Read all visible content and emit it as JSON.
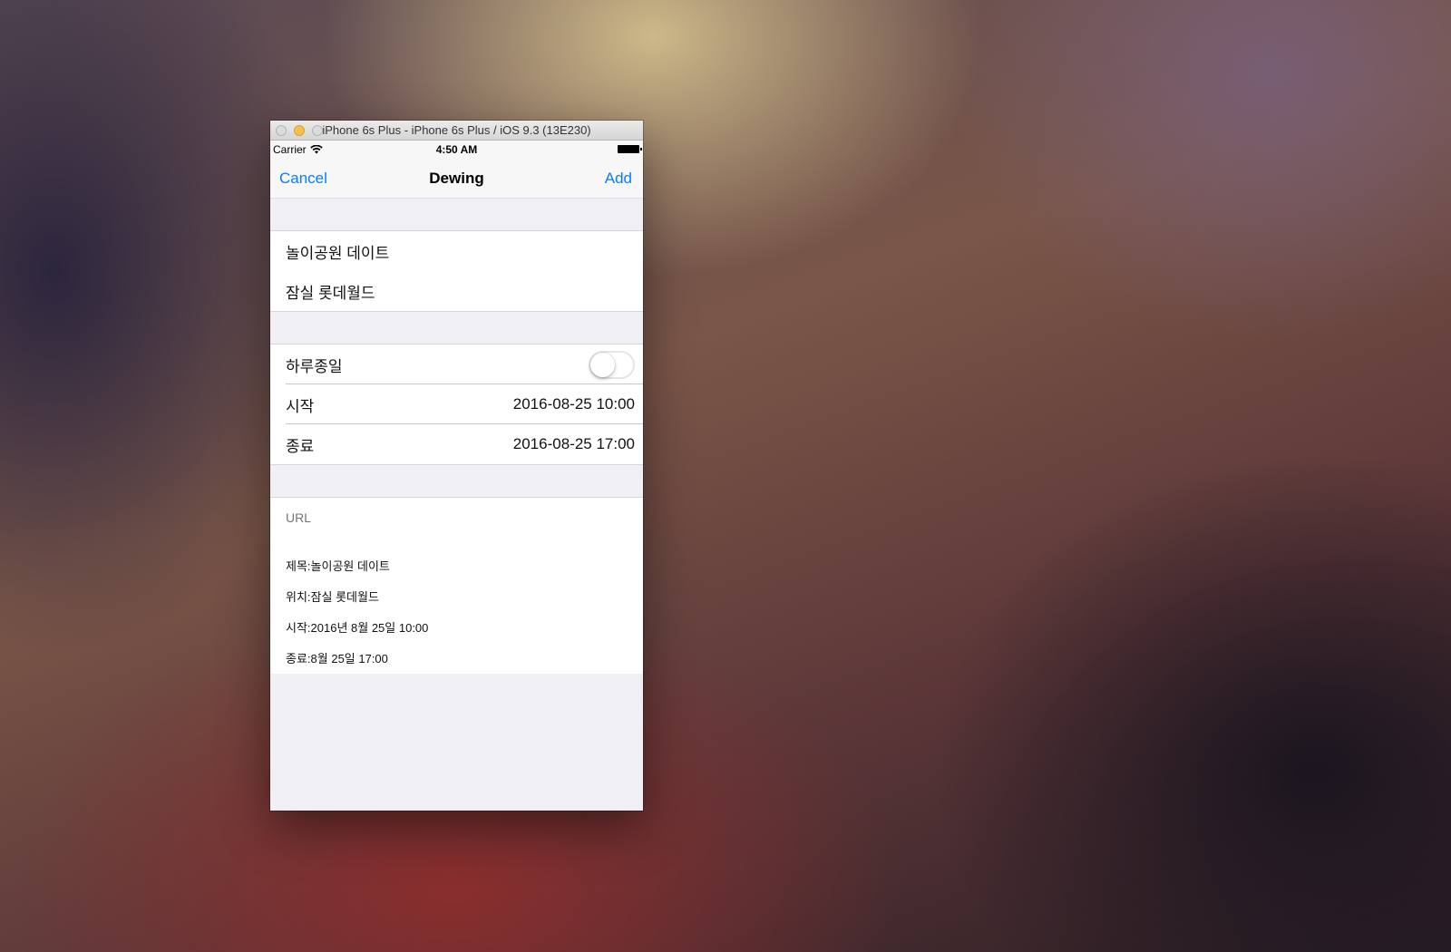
{
  "window": {
    "title": "iPhone 6s Plus - iPhone 6s Plus / iOS 9.3 (13E230)"
  },
  "status_bar": {
    "carrier": "Carrier",
    "time": "4:50 AM"
  },
  "nav": {
    "cancel_label": "Cancel",
    "title": "Dewing",
    "add_label": "Add"
  },
  "event": {
    "title_value": "놀이공원 데이트",
    "location_value": "잠실 롯데월드",
    "all_day_label": "하루종일",
    "all_day_on": false,
    "start_label": "시작",
    "start_value": "2016-08-25 10:00",
    "end_label": "종료",
    "end_value": "2016-08-25 17:00",
    "url_placeholder": "URL",
    "notes": [
      "제목:놀이공원 데이트",
      "위치:잠실 롯데월드",
      "시작:2016년 8월 25일 10:00",
      "종료:8월 25일 17:00"
    ]
  },
  "colors": {
    "tint": "#0a7aff",
    "group_background": "#efeff4"
  }
}
